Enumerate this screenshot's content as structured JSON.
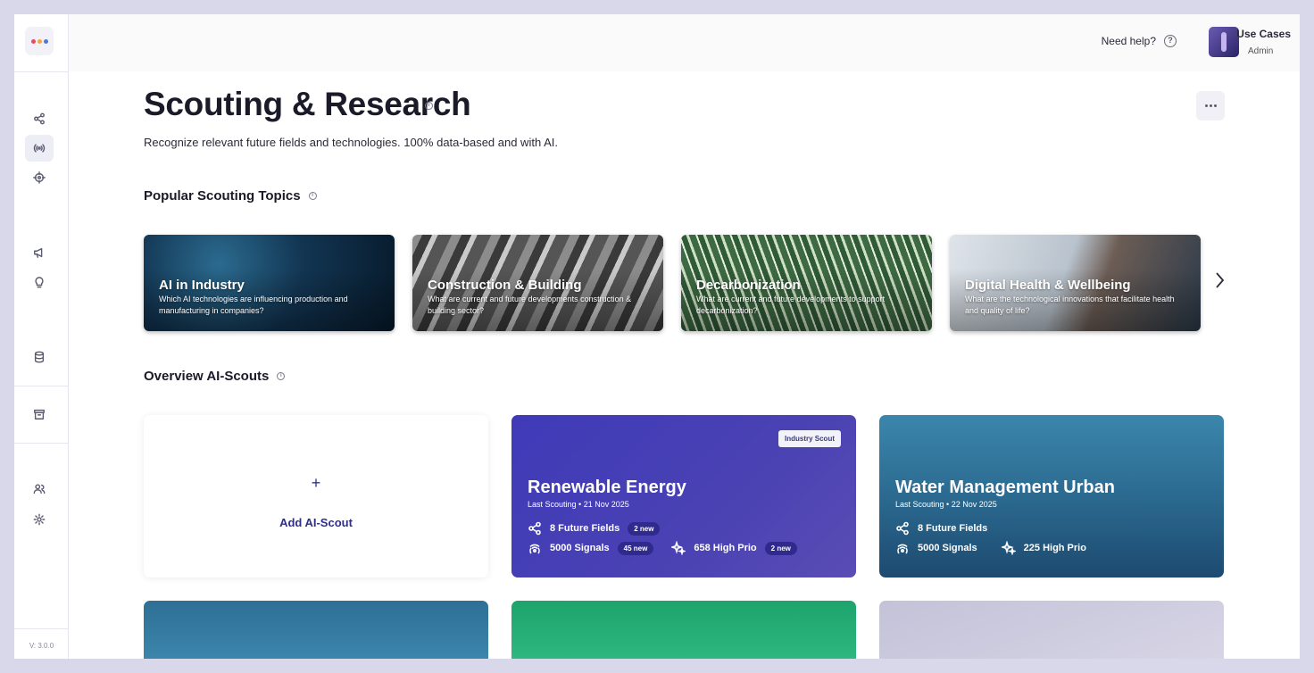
{
  "app": {
    "version": "V: 3.0.0"
  },
  "topbar": {
    "help_label": "Need help?",
    "help_icon": "?",
    "user_name": "Use Cases",
    "user_role": "Admin"
  },
  "page": {
    "title": "Scouting & Research",
    "subtitle": "Recognize relevant future fields and technologies. 100% data-based and with AI."
  },
  "sections": {
    "popular": "Popular Scouting Topics",
    "overview": "Overview AI-Scouts"
  },
  "topics": [
    {
      "title": "AI in Industry",
      "desc": "Which AI technologies are influencing production and manufacturing in companies?"
    },
    {
      "title": "Construction & Building",
      "desc": "What are current and future developments construction & building sector?"
    },
    {
      "title": "Decarbonization",
      "desc": "What are current and future developments to support decarbonization?"
    },
    {
      "title": "Digital Health & Wellbeing",
      "desc": "What are the technological innovations that facilitate health and quality of life?"
    }
  ],
  "add_scout": {
    "plus": "+",
    "label": "Add AI-Scout"
  },
  "scouts": [
    {
      "badge": "Industry Scout",
      "title": "Renewable Energy",
      "last": "Last Scouting  •  21 Nov 2025",
      "fields": "8  Future Fields",
      "fields_new": "2  new",
      "signals": "5000 Signals",
      "signals_new": "45  new",
      "prio": "658 High Prio",
      "prio_new": "2  new",
      "color": "#4a42b3"
    },
    {
      "title": "Water Management Urban",
      "last": "Last Scouting  •  22 Nov 2025",
      "fields": "8  Future Fields",
      "signals": "5000 Signals",
      "prio": "225 High Prio",
      "color": "#2d6d93"
    }
  ],
  "colors": {
    "accent": "#2f2f8a",
    "logo_dots": [
      "#e84a5f",
      "#f7a541",
      "#4a7bd9"
    ]
  }
}
